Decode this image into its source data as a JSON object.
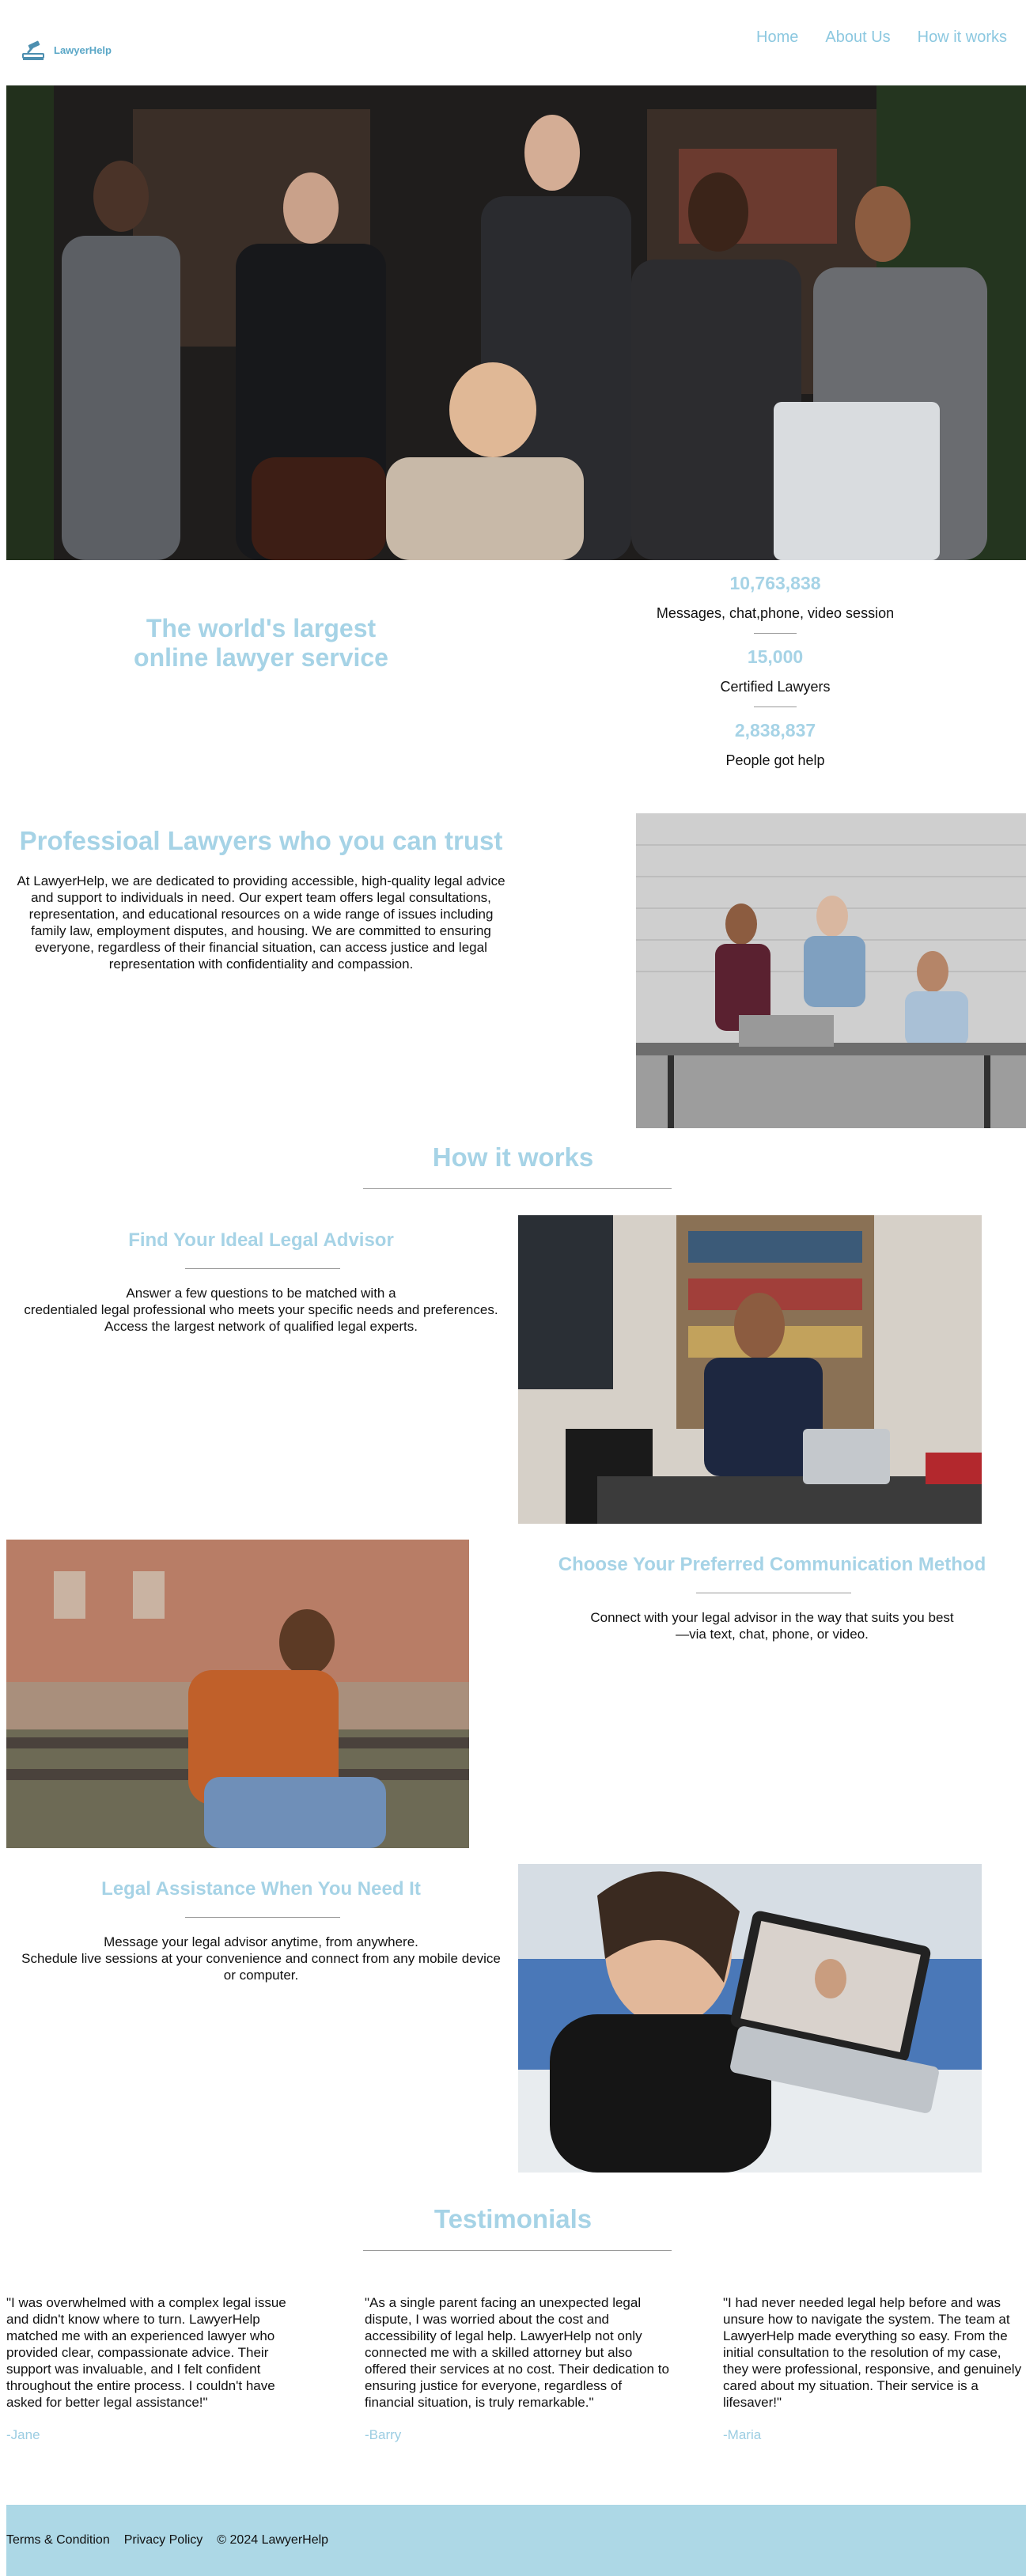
{
  "brand": {
    "name": "LawyerHelp",
    "logo_icon": "gavel-book-icon",
    "accent_color": "#a6d3e6",
    "footer_bg": "#add8e6"
  },
  "nav": {
    "items": [
      {
        "label": "Home"
      },
      {
        "label": "About Us"
      },
      {
        "label": "How it works"
      }
    ]
  },
  "hero": {
    "image": "team-of-lawyers-photo"
  },
  "tagline": {
    "line1": "The world's largest",
    "line2": "online lawyer service"
  },
  "stats": [
    {
      "value": "10,763,838",
      "label": "Messages, chat,phone, video session"
    },
    {
      "value": "15,000",
      "label": "Certified Lawyers"
    },
    {
      "value": "2,838,837",
      "label": "People got help"
    }
  ],
  "about": {
    "title": "Professioal Lawyers who you can trust",
    "text": "At LawyerHelp, we are dedicated to providing accessible, high-quality legal advice and support to individuals in need. Our expert team offers legal consultations, representation, and educational resources on a wide range of issues including family law, employment disputes, and housing. We are committed to ensuring everyone, regardless of their financial situation, can access justice and legal representation with confidentiality and compassion.",
    "image": "lawyers-at-desk-photo"
  },
  "how": {
    "title": "How it works",
    "steps": [
      {
        "title": "Find Your Ideal Legal Advisor",
        "line1": "Answer a few questions to be matched with a",
        "line2": "credentialed legal professional who meets your specific needs and preferences.",
        "line3": "Access the largest network of qualified legal experts.",
        "image": "lawyer-on-phone-photo"
      },
      {
        "title": "Choose Your Preferred Communication Method",
        "line1": "Connect with your legal advisor in the way that suits you best",
        "line2": "—via text, chat, phone, or video.",
        "image": "man-on-bench-with-phone-photo"
      },
      {
        "title": "Legal Assistance When You Need It",
        "line1": "Message your legal advisor anytime, from anywhere.",
        "line2": "Schedule live sessions at your convenience and connect from any mobile device",
        "line3": "or computer.",
        "image": "video-call-photo"
      }
    ]
  },
  "testimonials": {
    "title": "Testimonials",
    "items": [
      {
        "quote": "\"I was overwhelmed with a complex legal issue and didn't know where to turn. LawyerHelp matched me with an experienced lawyer who provided clear, compassionate advice. Their support was invaluable, and I felt confident throughout the entire process. I couldn't have asked for better legal assistance!\"",
        "author": "-Jane"
      },
      {
        "quote": "\"As a single parent facing an unexpected legal dispute, I was worried about the cost and accessibility of legal help. LawyerHelp not only connected me with a skilled attorney but also offered their services at no cost. Their dedication to ensuring justice for everyone, regardless of financial situation, is truly remarkable.\"",
        "author": "-Barry"
      },
      {
        "quote": "\"I had never needed legal help before and was unsure how to navigate the system. The team at LawyerHelp made everything so easy. From the initial consultation to the resolution of my case, they were professional, responsive, and genuinely cared about my situation. Their service is a lifesaver!\"",
        "author": "-Maria"
      }
    ]
  },
  "footer": {
    "terms": "Terms & Condition",
    "privacy": "Privacy Policy",
    "copyright": "© 2024 LawyerHelp"
  }
}
